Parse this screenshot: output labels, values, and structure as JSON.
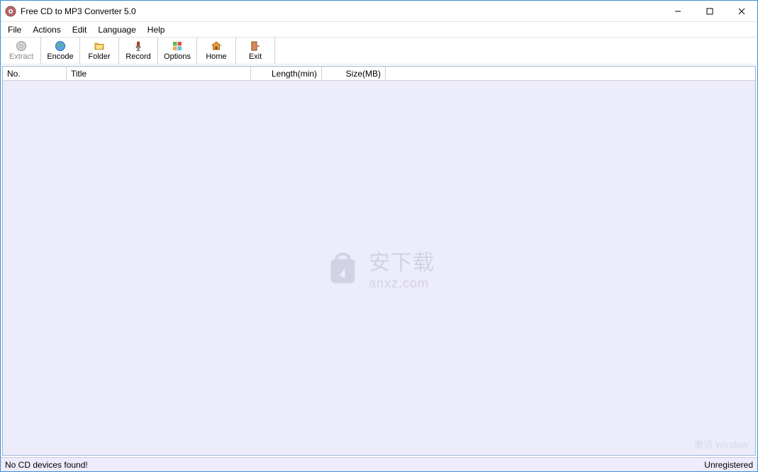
{
  "window": {
    "title": "Free CD to MP3 Converter 5.0"
  },
  "menu": {
    "items": [
      "File",
      "Actions",
      "Edit",
      "Language",
      "Help"
    ]
  },
  "toolbar": {
    "extract": "Extract",
    "encode": "Encode",
    "folder": "Folder",
    "record": "Record",
    "options": "Options",
    "home": "Home",
    "exit": "Exit"
  },
  "columns": {
    "no": "No.",
    "title": "Title",
    "length": "Length(min)",
    "size": "Size(MB)"
  },
  "rows": [],
  "watermark": {
    "line1": "安下载",
    "line2": "anxz.com"
  },
  "status": {
    "left": "No CD devices found!",
    "right": "Unregistered"
  },
  "activation_hint": "激活 Window"
}
